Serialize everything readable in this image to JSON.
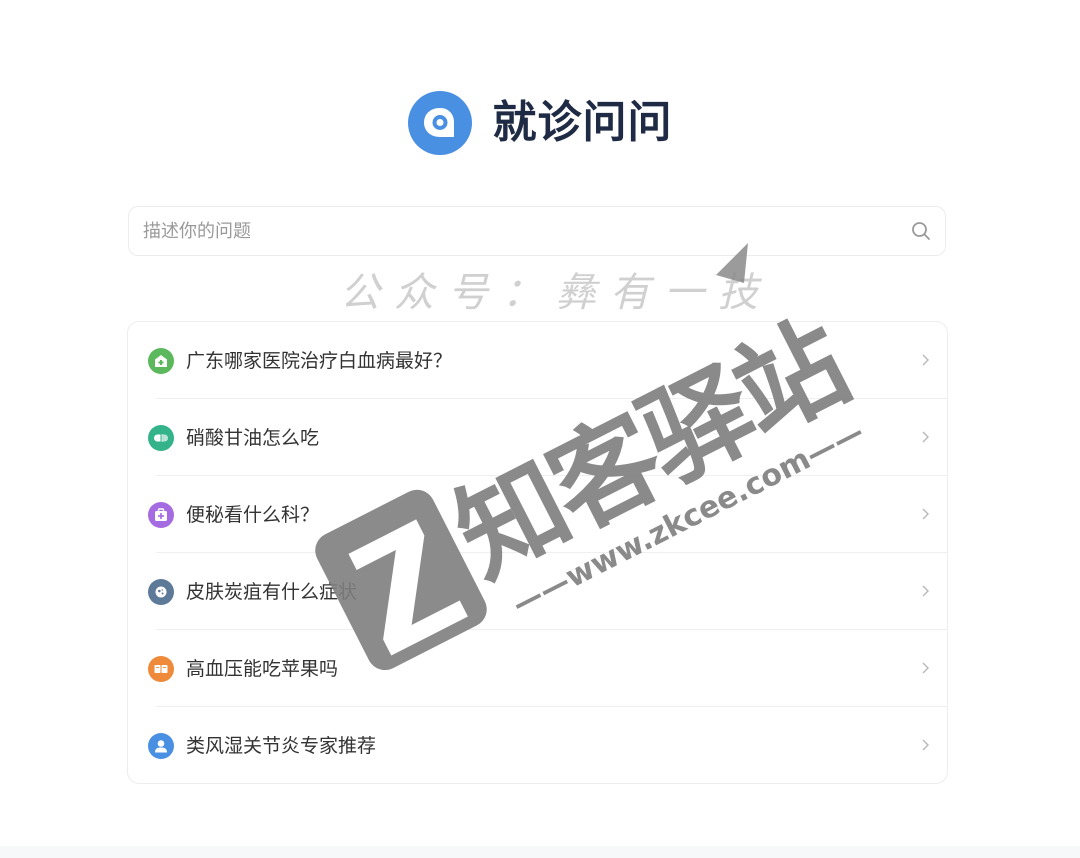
{
  "header": {
    "title": "就诊问问",
    "logo_color": "#4a90e2"
  },
  "search": {
    "placeholder": "描述你的问题",
    "value": ""
  },
  "questions": [
    {
      "text": "广东哪家医院治疗白血病最好？",
      "icon": "hospital-icon",
      "color": "#5cb85c"
    },
    {
      "text": "硝酸甘油怎么吃",
      "icon": "pill-icon",
      "color": "#34b38a"
    },
    {
      "text": "便秘看什么科？",
      "icon": "medkit-icon",
      "color": "#a56be0"
    },
    {
      "text": "皮肤炭疽有什么症状",
      "icon": "virus-icon",
      "color": "#5e7a99"
    },
    {
      "text": "高血压能吃苹果吗",
      "icon": "book-icon",
      "color": "#ee8a3a"
    },
    {
      "text": "类风湿关节炎专家推荐",
      "icon": "doctor-icon",
      "color": "#4a90e2"
    }
  ],
  "watermark": {
    "line1": "公众号：彝有一技",
    "brand": "知客驿站",
    "url": "——www.zkcee.com——"
  }
}
